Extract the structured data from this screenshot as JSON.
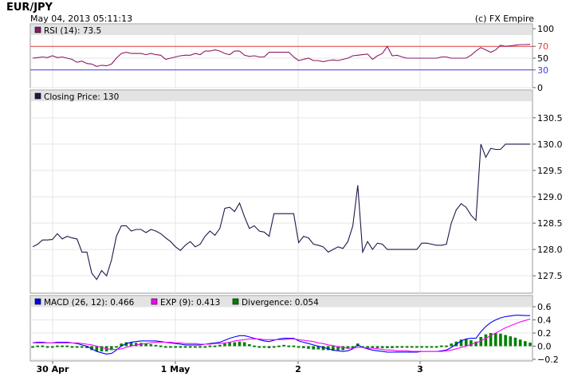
{
  "header": {
    "title": "EUR/JPY",
    "timestamp": "May 04, 2013 05:11:13",
    "copyright": "(c) FX Empire"
  },
  "colors": {
    "rsi": "#8b1a6b",
    "price": "#1a1a4a",
    "macd": "#0000ff",
    "exp": "#ff00ff",
    "divergence": "#008000",
    "overbought": "#e04040",
    "oversold": "#4040e0"
  },
  "chart_data": [
    {
      "type": "line",
      "legend": [
        "RSI (14): 73.5"
      ],
      "ylim": [
        0,
        100
      ],
      "yticks": [
        100,
        70,
        50,
        30,
        0
      ],
      "y_highlight_ticks": [
        70,
        30
      ],
      "ref_lines": [
        70,
        30
      ],
      "grid": true,
      "series": [
        {
          "name": "RSI (14): 73.5",
          "values": [
            50,
            51,
            52,
            51,
            54,
            51,
            52,
            50,
            48,
            43,
            45,
            41,
            40,
            36,
            38,
            37,
            40,
            50,
            58,
            60,
            58,
            58,
            58,
            56,
            58,
            56,
            55,
            48,
            50,
            52,
            54,
            55,
            55,
            58,
            56,
            62,
            62,
            64,
            62,
            58,
            56,
            62,
            62,
            55,
            53,
            54,
            52,
            52,
            60,
            60,
            60,
            60,
            60,
            52,
            46,
            48,
            50,
            46,
            46,
            44,
            46,
            47,
            46,
            48,
            50,
            54,
            55,
            56,
            57,
            48,
            54,
            58,
            70,
            54,
            55,
            52,
            50,
            50,
            50,
            50,
            50,
            50,
            50,
            52,
            52,
            50,
            50,
            50,
            50,
            55,
            62,
            68,
            64,
            60,
            64,
            72,
            70,
            71,
            72,
            73,
            73,
            73.5
          ]
        }
      ]
    },
    {
      "type": "line",
      "legend": [
        "Closing Price: 130"
      ],
      "ylim": [
        127.2,
        130.8
      ],
      "yticks": [
        130.5,
        130.0,
        129.5,
        129.0,
        128.5,
        128.0,
        127.5
      ],
      "ytick_labels": [
        "130.5",
        "130.0",
        "129.5",
        "129.0",
        "128.5",
        "128.0",
        "127.5"
      ],
      "grid": true,
      "series": [
        {
          "name": "Closing Price: 130",
          "values": [
            128.05,
            128.1,
            128.18,
            128.18,
            128.19,
            128.3,
            128.2,
            128.25,
            128.22,
            128.2,
            127.95,
            127.95,
            127.55,
            127.43,
            127.6,
            127.5,
            127.8,
            128.25,
            128.45,
            128.45,
            128.35,
            128.38,
            128.38,
            128.32,
            128.38,
            128.35,
            128.3,
            128.22,
            128.15,
            128.05,
            127.98,
            128.08,
            128.15,
            128.05,
            128.1,
            128.25,
            128.35,
            128.27,
            128.4,
            128.78,
            128.8,
            128.72,
            128.88,
            128.62,
            128.4,
            128.45,
            128.35,
            128.33,
            128.25,
            128.68,
            128.68,
            128.68,
            128.68,
            128.68,
            128.13,
            128.25,
            128.22,
            128.1,
            128.08,
            128.05,
            127.95,
            128.0,
            128.05,
            128.02,
            128.15,
            128.45,
            129.22,
            127.95,
            128.15,
            128.0,
            128.12,
            128.1,
            128.0,
            128.0,
            128.0,
            128.0,
            128.0,
            128.0,
            128.0,
            128.12,
            128.12,
            128.1,
            128.08,
            128.08,
            128.1,
            128.5,
            128.75,
            128.87,
            128.8,
            128.65,
            128.55,
            130.0,
            129.75,
            129.92,
            129.9,
            129.9,
            130.0,
            130.0,
            130.0,
            130.0,
            130.0,
            130.0
          ]
        }
      ]
    },
    {
      "type": "line",
      "legend": [
        "MACD (26, 12): 0.466",
        "EXP (9): 0.413",
        "Divergence: 0.054"
      ],
      "ylim": [
        -0.2,
        0.6
      ],
      "yticks": [
        0.6,
        0.4,
        0.2,
        0.0,
        -0.2
      ],
      "ytick_labels": [
        "0.6",
        "0.4",
        "0.2",
        "0.0",
        "−0.2"
      ],
      "grid": true,
      "x_tick_labels": [
        "30 Apr",
        "1 May",
        "2",
        "3"
      ],
      "series": [
        {
          "name": "MACD (26, 12): 0.466",
          "values": [
            0.05,
            0.06,
            0.06,
            0.05,
            0.05,
            0.06,
            0.06,
            0.06,
            0.05,
            0.04,
            0.02,
            0.0,
            -0.04,
            -0.08,
            -0.1,
            -0.12,
            -0.11,
            -0.06,
            0.0,
            0.04,
            0.06,
            0.07,
            0.08,
            0.08,
            0.08,
            0.08,
            0.07,
            0.06,
            0.05,
            0.04,
            0.03,
            0.02,
            0.02,
            0.02,
            0.02,
            0.03,
            0.04,
            0.05,
            0.06,
            0.09,
            0.12,
            0.14,
            0.16,
            0.16,
            0.14,
            0.12,
            0.1,
            0.08,
            0.07,
            0.09,
            0.11,
            0.12,
            0.12,
            0.12,
            0.08,
            0.06,
            0.04,
            0.02,
            0.0,
            -0.02,
            -0.04,
            -0.06,
            -0.07,
            -0.08,
            -0.07,
            -0.04,
            0.02,
            -0.02,
            -0.04,
            -0.06,
            -0.07,
            -0.08,
            -0.09,
            -0.09,
            -0.09,
            -0.09,
            -0.09,
            -0.09,
            -0.09,
            -0.08,
            -0.08,
            -0.08,
            -0.08,
            -0.07,
            -0.06,
            -0.02,
            0.03,
            0.08,
            0.11,
            0.12,
            0.12,
            0.22,
            0.3,
            0.36,
            0.4,
            0.43,
            0.45,
            0.46,
            0.47,
            0.47,
            0.466,
            0.466
          ]
        },
        {
          "name": "EXP (9): 0.413",
          "values": [
            0.05,
            0.05,
            0.05,
            0.05,
            0.05,
            0.05,
            0.05,
            0.05,
            0.05,
            0.05,
            0.04,
            0.03,
            0.02,
            0.0,
            -0.02,
            -0.04,
            -0.05,
            -0.05,
            -0.04,
            -0.02,
            0.0,
            0.02,
            0.03,
            0.04,
            0.05,
            0.06,
            0.06,
            0.06,
            0.06,
            0.05,
            0.05,
            0.04,
            0.04,
            0.04,
            0.03,
            0.03,
            0.03,
            0.04,
            0.04,
            0.05,
            0.06,
            0.08,
            0.09,
            0.1,
            0.11,
            0.11,
            0.11,
            0.1,
            0.1,
            0.1,
            0.1,
            0.1,
            0.11,
            0.11,
            0.1,
            0.09,
            0.08,
            0.07,
            0.05,
            0.04,
            0.02,
            0.01,
            -0.01,
            -0.02,
            -0.03,
            -0.03,
            -0.02,
            -0.02,
            -0.03,
            -0.03,
            -0.04,
            -0.05,
            -0.06,
            -0.06,
            -0.07,
            -0.07,
            -0.07,
            -0.08,
            -0.08,
            -0.08,
            -0.08,
            -0.08,
            -0.08,
            -0.08,
            -0.07,
            -0.06,
            -0.04,
            -0.02,
            0.0,
            0.03,
            0.05,
            0.08,
            0.12,
            0.16,
            0.2,
            0.24,
            0.28,
            0.31,
            0.34,
            0.37,
            0.39,
            0.413
          ]
        },
        {
          "name": "Divergence: 0.054",
          "values": [
            0.0,
            0.01,
            0.01,
            0.0,
            0.0,
            0.01,
            0.01,
            0.01,
            0.0,
            -0.01,
            -0.02,
            -0.03,
            -0.06,
            -0.08,
            -0.08,
            -0.08,
            -0.06,
            -0.01,
            0.04,
            0.06,
            0.06,
            0.05,
            0.05,
            0.04,
            0.03,
            0.02,
            0.01,
            0.0,
            -0.01,
            -0.01,
            -0.02,
            -0.02,
            -0.02,
            -0.02,
            -0.01,
            0.0,
            0.01,
            0.01,
            0.02,
            0.04,
            0.06,
            0.06,
            0.07,
            0.06,
            0.03,
            0.01,
            -0.01,
            -0.02,
            -0.03,
            -0.01,
            0.01,
            0.02,
            0.01,
            0.01,
            -0.02,
            -0.03,
            -0.04,
            -0.05,
            -0.05,
            -0.06,
            -0.06,
            -0.07,
            -0.06,
            -0.06,
            -0.04,
            -0.01,
            0.04,
            0.0,
            -0.01,
            -0.03,
            -0.03,
            -0.03,
            -0.03,
            -0.03,
            -0.02,
            -0.02,
            -0.02,
            -0.01,
            -0.01,
            0.0,
            0.0,
            0.0,
            0.0,
            0.01,
            0.01,
            0.04,
            0.07,
            0.1,
            0.11,
            0.09,
            0.07,
            0.14,
            0.18,
            0.2,
            0.2,
            0.19,
            0.17,
            0.15,
            0.13,
            0.1,
            0.076,
            0.054
          ]
        }
      ]
    }
  ]
}
